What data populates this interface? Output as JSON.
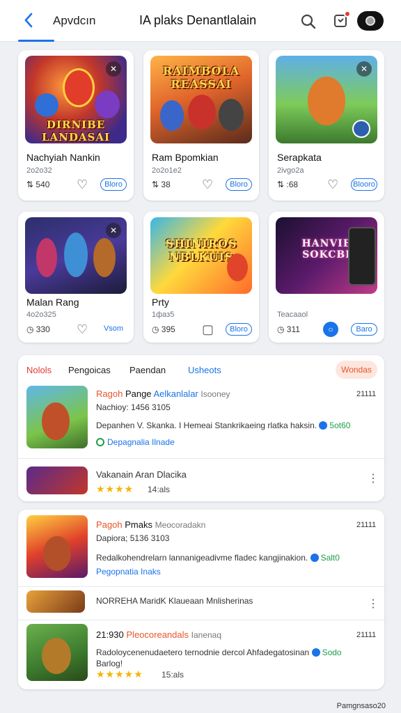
{
  "header": {
    "back_icon": "chevron-left-icon",
    "tab_label": "Apvdcın",
    "title": "IA plaks Denantlalain",
    "search_icon": "search-icon",
    "notifications_icon": "bell-icon",
    "accent_color": "#1a73e8"
  },
  "grid": [
    {
      "name": "Nachyiah Nankin",
      "sub": "2о2о32",
      "stat": "⇅ 540",
      "pill": "Bloro",
      "art": "DIRNIBE LANDASAI",
      "corner": "✕"
    },
    {
      "name": "Ram Bpomkian",
      "sub": "2о2о1е2",
      "stat": "⇅ 38",
      "pill": "Bloro",
      "art": "RAIMBOLA REASSAI",
      "corner": ""
    },
    {
      "name": "Serapkata",
      "sub": "2ivgo2a",
      "stat": "⇅ :68",
      "pill": "Blooro",
      "art": "",
      "corner": "✕"
    },
    {
      "name": "Malan Rang",
      "sub": "4о2о325",
      "stat": "◷ 330",
      "pill": "Vsom",
      "art": "",
      "corner": "✕"
    },
    {
      "name": "Prty",
      "sub": "1фаз5",
      "stat": "◷ 395",
      "pill": "Bloro",
      "art": "SHINIROS NBLKUIS",
      "corner": ""
    },
    {
      "name": "",
      "sub": "Teacaaol",
      "stat": "◷ 311",
      "pill": "Baro",
      "art": "HANVIE SOKCBI",
      "corner": ""
    }
  ],
  "list": {
    "tabs": [
      "Nolols",
      "Pengoicas",
      "Paendan",
      "Usheots"
    ],
    "filter": "Wondas",
    "rows": [
      {
        "title_a": "Ragoh",
        "title_b": "Pange",
        "title_c": "Aelkanlalar",
        "title_d": "Isooney",
        "num": "21111",
        "meta": "Nachioy: 1456 3105",
        "desc": "Depanhen V. Skanka. I Hemeai Stankrikaeing rlatka haksin.",
        "desc_ok": "5ot60",
        "link": "Depagnalia Ilnade"
      },
      {
        "title_a": "",
        "title_b": "",
        "title_c": "",
        "title_d": "",
        "num": "",
        "meta": "",
        "desc": "Vakanain Aran Dlacika",
        "desc_ok": "",
        "link": "",
        "stars": "★★★★",
        "stars_text": "14:als"
      },
      {
        "title_a": "Pagoh",
        "title_b": "Pmaks",
        "title_c": "",
        "title_d": "Meocoradakn",
        "num": "21111",
        "meta": "Dapiora; 5136 3103",
        "desc": "Redalkohendrelarn lannanigeadivme fladec kangjinakion.",
        "desc_ok": "Salt0",
        "link": "Pegopnatia Inaks"
      },
      {
        "title_a": "",
        "title_b": "",
        "title_c": "",
        "title_d": "",
        "num": "",
        "meta": "",
        "desc": "NORREHA MaridK Klaueaan Mnlisherinas",
        "desc_ok": "",
        "link": ""
      },
      {
        "title_a": "21:930",
        "title_b": "",
        "title_c": "Pleocoreandals",
        "title_d": "Ianenaq",
        "num": "21111",
        "meta": "",
        "desc": "Radoloycenenudaetero ternodnie dercol Ahfadegatosinan",
        "desc_ok": "Sodo",
        "link": "Barlog!",
        "stars": "★★★★★",
        "stars_text": "15:als"
      }
    ]
  },
  "footer": "Pamgnsaso20"
}
